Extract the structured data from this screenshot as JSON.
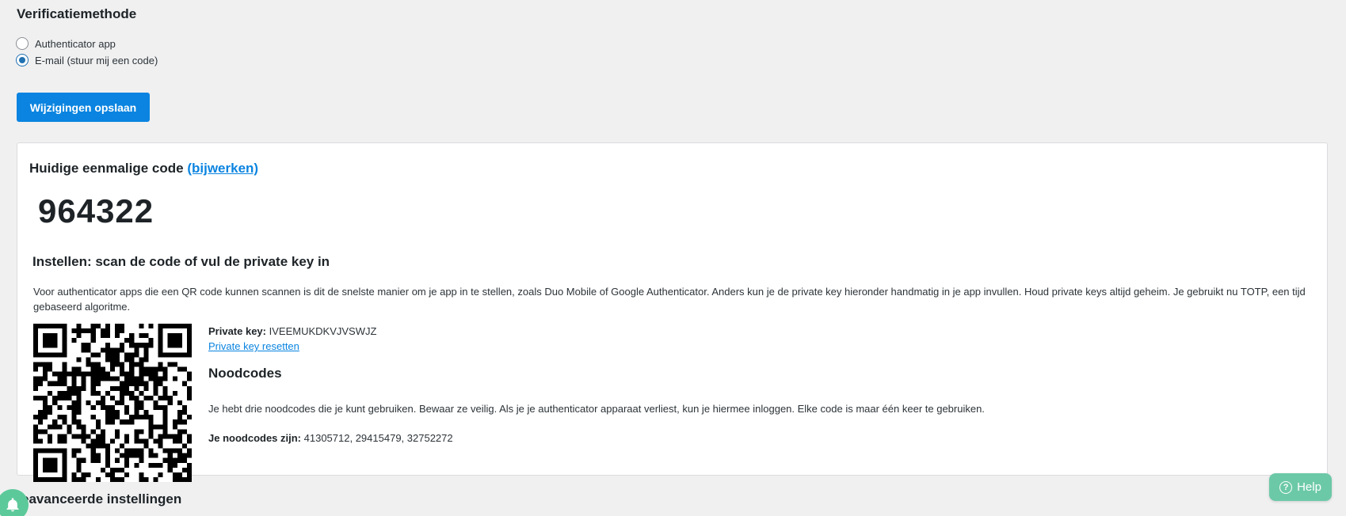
{
  "verification": {
    "title": "Verificatiemethode",
    "options": [
      {
        "label": "Authenticator app",
        "checked": false
      },
      {
        "label": "E-mail (stuur mij een code)",
        "checked": true
      }
    ],
    "save_label": "Wijzigingen opslaan"
  },
  "card": {
    "current_code_label": "Huidige eenmalige code",
    "refresh_link": "(bijwerken)",
    "otp": "964322",
    "setup_heading": "Instellen: scan de code of vul de private key in",
    "setup_description": "Voor authenticator apps die een QR code kunnen scannen is dit de snelste manier om je app in te stellen, zoals Duo Mobile of Google Authenticator. Anders kun je de private key hieronder handmatig in je app invullen. Houd private keys altijd geheim. Je gebruikt nu TOTP, een tijd gebaseerd algoritme.",
    "private_key_label": "Private key:",
    "private_key_value": "IVEEMUKDKVJVSWJZ",
    "reset_link": "Private key resetten",
    "backup_heading": "Noodcodes",
    "backup_description": "Je hebt drie noodcodes die je kunt gebruiken. Bewaar ze veilig. Als je je authenticator apparaat verliest, kun je hiermee inloggen. Elke code is maar één keer te gebruiken.",
    "backup_codes_label": "Je noodcodes zijn:",
    "backup_codes_value": "41305712, 29415479, 32752272"
  },
  "advanced": {
    "title": "eavanceerde instellingen"
  },
  "help": {
    "label": "Help",
    "icon": "question-circle-icon"
  },
  "notifications": {
    "icon": "bell-icon"
  },
  "colors": {
    "accent": "#0a84e0",
    "help": "#6cc9a8",
    "bell": "#5cc99a"
  }
}
